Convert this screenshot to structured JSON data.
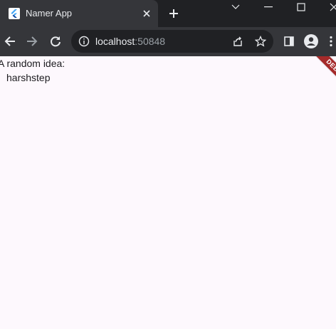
{
  "colors": {
    "tabstrip_bg": "#202124",
    "toolbar_bg": "#35363a",
    "page_bg": "#fdf8fd",
    "debug_ribbon": "#a52a2a"
  },
  "browser": {
    "tab": {
      "title": "Namer App",
      "favicon": "flutter-icon"
    },
    "address": {
      "host": "localhost",
      "port": ":50848"
    },
    "icons": [
      "back-icon",
      "forward-icon",
      "reload-icon",
      "info-icon",
      "share-icon",
      "star-icon",
      "side-panel-icon",
      "profile-icon",
      "menu-icon"
    ]
  },
  "page": {
    "label": "A random idea:",
    "word": "harshstep",
    "debug_banner": "DEBUG"
  }
}
